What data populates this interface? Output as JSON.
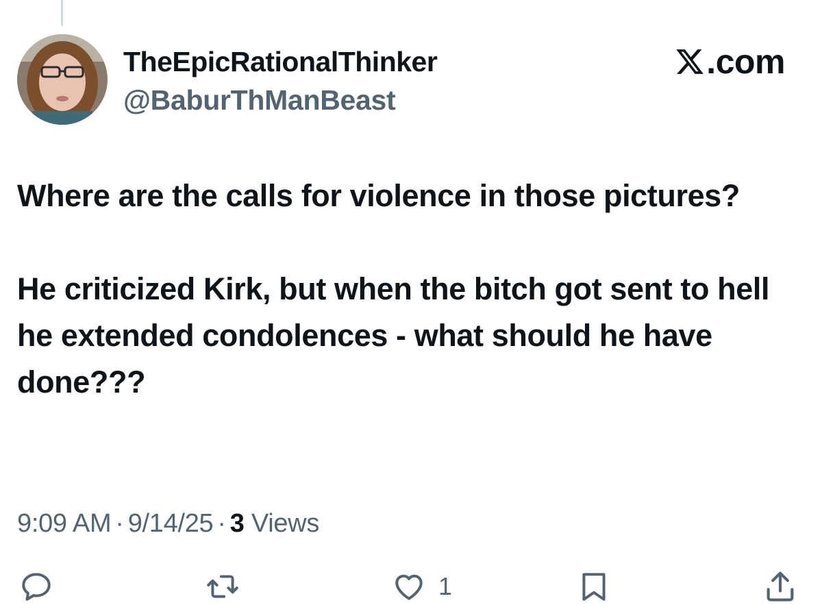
{
  "author": {
    "display_name": "TheEpicRationalThinker",
    "handle": "@BaburThManBeast",
    "avatar_icon": "profile-photo"
  },
  "brand": {
    "text": ".com",
    "logo_icon": "x-logo-icon"
  },
  "tweet": {
    "paragraphs": [
      "Where are the calls for violence in those pictures?",
      "He criticized Kirk, but when the bitch got sent to hell he extended condolences - what should he have done???"
    ]
  },
  "meta": {
    "time": "9:09 AM",
    "separator": "·",
    "date": "9/14/25",
    "views_count": "3",
    "views_label": "Views"
  },
  "actions": {
    "reply_icon": "reply-icon",
    "retweet_icon": "retweet-icon",
    "like_icon": "heart-icon",
    "like_count": "1",
    "bookmark_icon": "bookmark-icon",
    "share_icon": "share-icon"
  },
  "colors": {
    "text_primary": "#0f1419",
    "text_secondary": "#536471",
    "thread_line": "#cfd9de"
  }
}
